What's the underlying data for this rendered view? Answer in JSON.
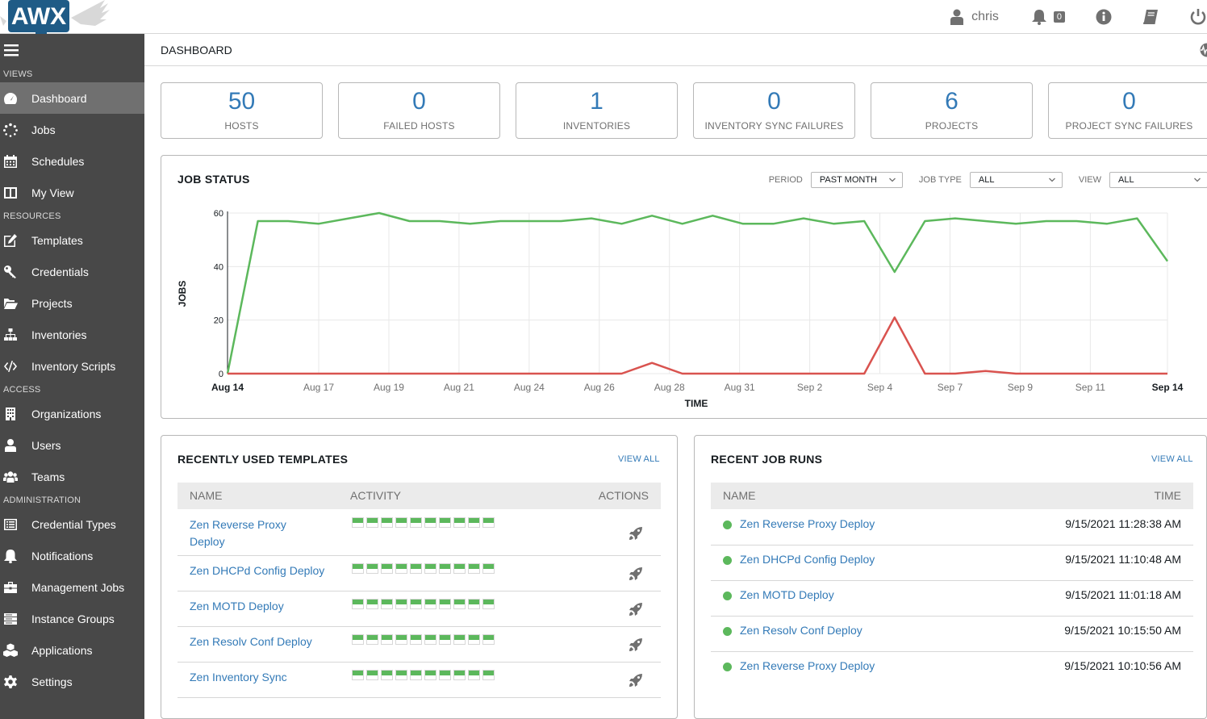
{
  "app": {
    "logo_text": "AWX"
  },
  "topbar": {
    "username": "chris",
    "notification_count": "0"
  },
  "sidebar": {
    "sections": [
      {
        "label": "VIEWS",
        "items": [
          {
            "label": "Dashboard",
            "icon": "tachometer-icon",
            "active": true
          },
          {
            "label": "Jobs",
            "icon": "spinner-icon"
          },
          {
            "label": "Schedules",
            "icon": "calendar-icon"
          },
          {
            "label": "My View",
            "icon": "columns-icon"
          }
        ]
      },
      {
        "label": "RESOURCES",
        "items": [
          {
            "label": "Templates",
            "icon": "pencil-square-icon"
          },
          {
            "label": "Credentials",
            "icon": "key-icon"
          },
          {
            "label": "Projects",
            "icon": "folder-open-icon"
          },
          {
            "label": "Inventories",
            "icon": "sitemap-icon"
          },
          {
            "label": "Inventory Scripts",
            "icon": "code-icon"
          }
        ]
      },
      {
        "label": "ACCESS",
        "items": [
          {
            "label": "Organizations",
            "icon": "building-icon"
          },
          {
            "label": "Users",
            "icon": "user-icon"
          },
          {
            "label": "Teams",
            "icon": "users-icon"
          }
        ]
      },
      {
        "label": "ADMINISTRATION",
        "items": [
          {
            "label": "Credential Types",
            "icon": "list-alt-icon"
          },
          {
            "label": "Notifications",
            "icon": "bell-icon"
          },
          {
            "label": "Management Jobs",
            "icon": "briefcase-icon"
          },
          {
            "label": "Instance Groups",
            "icon": "server-icon"
          },
          {
            "label": "Applications",
            "icon": "cubes-icon"
          },
          {
            "label": "Settings",
            "icon": "cog-icon"
          }
        ]
      }
    ]
  },
  "breadcrumb": {
    "title": "DASHBOARD"
  },
  "counts": [
    {
      "value": "50",
      "label": "HOSTS"
    },
    {
      "value": "0",
      "label": "FAILED HOSTS"
    },
    {
      "value": "1",
      "label": "INVENTORIES"
    },
    {
      "value": "0",
      "label": "INVENTORY SYNC FAILURES"
    },
    {
      "value": "6",
      "label": "PROJECTS"
    },
    {
      "value": "0",
      "label": "PROJECT SYNC FAILURES"
    }
  ],
  "job_status": {
    "title": "JOB STATUS",
    "filters": [
      {
        "label": "PERIOD",
        "value": "PAST MONTH"
      },
      {
        "label": "JOB TYPE",
        "value": "ALL"
      },
      {
        "label": "VIEW",
        "value": "ALL"
      }
    ]
  },
  "chart_data": {
    "type": "line",
    "title": "",
    "xlabel": "TIME",
    "ylabel": "JOBS",
    "ylim": [
      0,
      60
    ],
    "yticks": [
      0,
      20,
      40,
      60
    ],
    "grid": true,
    "x": [
      "Aug 14",
      "Aug 15",
      "Aug 16",
      "Aug 17",
      "Aug 18",
      "Aug 19",
      "Aug 20",
      "Aug 21",
      "Aug 22",
      "Aug 23",
      "Aug 24",
      "Aug 25",
      "Aug 26",
      "Aug 27",
      "Aug 28",
      "Aug 29",
      "Aug 30",
      "Aug 31",
      "Sep 1",
      "Sep 2",
      "Sep 3",
      "Sep 4",
      "Sep 5",
      "Sep 6",
      "Sep 7",
      "Sep 8",
      "Sep 9",
      "Sep 10",
      "Sep 11",
      "Sep 12",
      "Sep 13",
      "Sep 14"
    ],
    "xtick_labels": [
      {
        "label": "Aug 14",
        "index": 0,
        "bold": true
      },
      {
        "label": "Aug 17",
        "index": 2.6
      },
      {
        "label": "Aug 19",
        "index": 4.6
      },
      {
        "label": "Aug 21",
        "index": 6.6
      },
      {
        "label": "Aug 24",
        "index": 8.6
      },
      {
        "label": "Aug 26",
        "index": 10.6
      },
      {
        "label": "Aug 28",
        "index": 12.6
      },
      {
        "label": "Aug 31",
        "index": 14.6
      },
      {
        "label": "Sep 2",
        "index": 16.6
      },
      {
        "label": "Sep 4",
        "index": 18.6
      },
      {
        "label": "Sep 7",
        "index": 20.6
      },
      {
        "label": "Sep 9",
        "index": 22.6
      },
      {
        "label": "Sep 11",
        "index": 24.6
      },
      {
        "label": "Sep 14",
        "index": 26.8,
        "bold": true
      }
    ],
    "series": [
      {
        "color": "#5cb85c",
        "values": [
          0,
          57,
          57,
          56,
          58,
          60,
          57,
          57,
          56,
          57,
          57,
          57,
          58,
          56,
          59,
          56,
          59,
          56,
          56,
          58,
          56,
          57,
          38,
          57,
          58,
          57,
          56,
          57,
          57,
          56,
          58,
          42
        ]
      },
      {
        "color": "#d9534f",
        "values": [
          0,
          0,
          0,
          0,
          0,
          0,
          0,
          0,
          0,
          0,
          0,
          0,
          0,
          0,
          4,
          0,
          0,
          0,
          0,
          0,
          0,
          0,
          21,
          0,
          0,
          1,
          0,
          0,
          0,
          0,
          0,
          0
        ]
      }
    ]
  },
  "templates": {
    "title": "RECENTLY USED TEMPLATES",
    "view_all": "VIEW ALL",
    "columns": {
      "name": "NAME",
      "activity": "ACTIVITY",
      "actions": "ACTIONS"
    },
    "rows": [
      {
        "name_line1": "Zen Reverse Proxy",
        "name_line2": "Deploy"
      },
      {
        "name_line1": "Zen DHCPd Config Deploy",
        "name_line2": ""
      },
      {
        "name_line1": "Zen MOTD Deploy",
        "name_line2": ""
      },
      {
        "name_line1": "Zen Resolv Conf Deploy",
        "name_line2": ""
      },
      {
        "name_line1": "Zen Inventory Sync",
        "name_line2": ""
      }
    ]
  },
  "recent_jobs": {
    "title": "RECENT JOB RUNS",
    "view_all": "VIEW ALL",
    "columns": {
      "name": "NAME",
      "time": "TIME"
    },
    "rows": [
      {
        "name": "Zen Reverse Proxy Deploy",
        "time": "9/15/2021 11:28:38 AM"
      },
      {
        "name": "Zen DHCPd Config Deploy",
        "time": "9/15/2021 11:10:48 AM"
      },
      {
        "name": "Zen MOTD Deploy",
        "time": "9/15/2021 11:01:18 AM"
      },
      {
        "name": "Zen Resolv Conf Deploy",
        "time": "9/15/2021 10:15:50 AM"
      },
      {
        "name": "Zen Reverse Proxy Deploy",
        "time": "9/15/2021 10:10:56 AM"
      }
    ]
  }
}
